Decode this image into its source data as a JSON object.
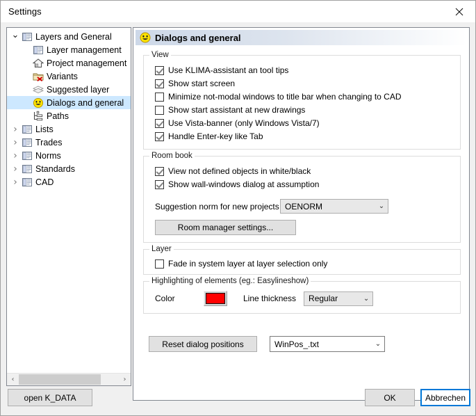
{
  "window": {
    "title": "Settings",
    "close_icon": "close-x-icon"
  },
  "tree": {
    "items": [
      {
        "label": "Layers and General",
        "icon": "window-icon",
        "chevron": "down",
        "level": 0,
        "selected": false
      },
      {
        "label": "Layer management",
        "icon": "layer-window-icon",
        "chevron": "none",
        "level": 1,
        "selected": false
      },
      {
        "label": "Project management",
        "icon": "house-icon",
        "chevron": "none",
        "level": 1,
        "selected": false
      },
      {
        "label": "Variants",
        "icon": "folder-delete-icon",
        "chevron": "none",
        "level": 1,
        "selected": false
      },
      {
        "label": "Suggested layer",
        "icon": "stacked-layers-icon",
        "chevron": "none",
        "level": 1,
        "selected": false
      },
      {
        "label": "Dialogs and general",
        "icon": "smiley-icon",
        "chevron": "none",
        "level": 1,
        "selected": true
      },
      {
        "label": "Paths",
        "icon": "tree-paths-icon",
        "chevron": "none",
        "level": 1,
        "selected": false
      },
      {
        "label": "Lists",
        "icon": "window-icon",
        "chevron": "right",
        "level": 0,
        "selected": false
      },
      {
        "label": "Trades",
        "icon": "window-icon",
        "chevron": "right",
        "level": 0,
        "selected": false
      },
      {
        "label": "Norms",
        "icon": "window-icon",
        "chevron": "right",
        "level": 0,
        "selected": false
      },
      {
        "label": "Standards",
        "icon": "window-icon",
        "chevron": "right",
        "level": 0,
        "selected": false
      },
      {
        "label": "CAD",
        "icon": "window-icon",
        "chevron": "right",
        "level": 0,
        "selected": false
      }
    ],
    "scrollbar": {
      "left_arrow": "‹",
      "right_arrow": "›"
    }
  },
  "panel": {
    "header_title": "Dialogs and general",
    "header_icon": "smiley-icon",
    "groups": {
      "view": {
        "legend": "View",
        "checkboxes": [
          {
            "label": "Use KLIMA-assistant an tool tips",
            "checked": true
          },
          {
            "label": "Show start screen",
            "checked": true
          },
          {
            "label": "Minimize not-modal windows to title bar when changing to CAD",
            "checked": false
          },
          {
            "label": "Show start assistant at new drawings",
            "checked": false
          },
          {
            "label": "Use Vista-banner (only Windows Vista/7)",
            "checked": true
          },
          {
            "label": "Handle Enter-key like Tab",
            "checked": true
          }
        ]
      },
      "room_book": {
        "legend": "Room book",
        "checkboxes": [
          {
            "label": "View not defined objects in white/black",
            "checked": true
          },
          {
            "label": "Show wall-windows dialog at assumption",
            "checked": true
          }
        ],
        "norm_label": "Suggestion norm for new projects",
        "norm_value": "OENORM",
        "room_manager_button": "Room manager settings..."
      },
      "layer": {
        "legend": "Layer",
        "checkboxes": [
          {
            "label": "Fade in system layer at layer selection only",
            "checked": false
          }
        ]
      },
      "highlighting": {
        "legend": "Highlighting of elements (eg.: Easylineshow)",
        "color_label": "Color",
        "color_value": "#FF0000",
        "line_thickness_label": "Line thickness",
        "line_thickness_value": "Regular"
      }
    },
    "reset_button": "Reset dialog positions",
    "winpos_value": "WinPos_.txt",
    "dropdown_arrow": "⌄"
  },
  "footer": {
    "open_kdata": "open K_DATA",
    "ok": "OK",
    "cancel": "Abbrechen"
  }
}
